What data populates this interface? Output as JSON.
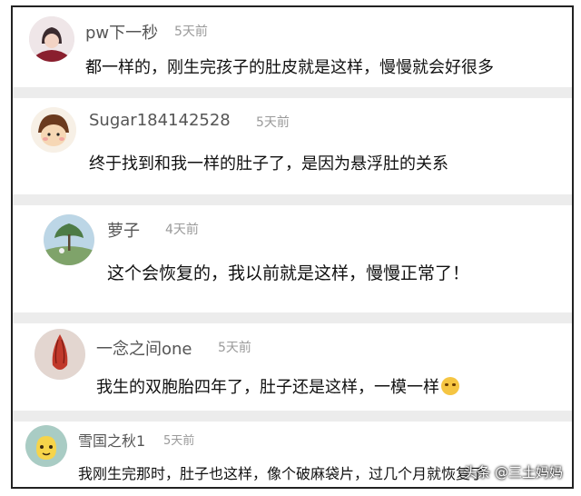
{
  "comments": [
    {
      "username": "pw下一秒",
      "time": "5天前",
      "content": "都一样的，刚生完孩子的肚皮就是这样，慢慢就会好很多"
    },
    {
      "username": "Sugar184142528",
      "time": "5天前",
      "content": "终于找到和我一样的肚子了，是因为悬浮肚的关系"
    },
    {
      "username": "萝子",
      "time": "4天前",
      "content": "这个会恢复的，我以前就是这样，慢慢正常了！"
    },
    {
      "username": "一念之间one",
      "time": "5天前",
      "content": "我生的双胞胎四年了，肚子还是这样，一模一样"
    },
    {
      "username": "雪国之秋1",
      "time": "5天前",
      "content": "我刚生完那时，肚子也这样，像个破麻袋片，过几个月就恢复了"
    }
  ],
  "watermark": "头条 @三土妈妈",
  "colors": {
    "separator": "#ececec",
    "username": "#555555",
    "time": "#9a9a9a",
    "content": "#111111"
  }
}
